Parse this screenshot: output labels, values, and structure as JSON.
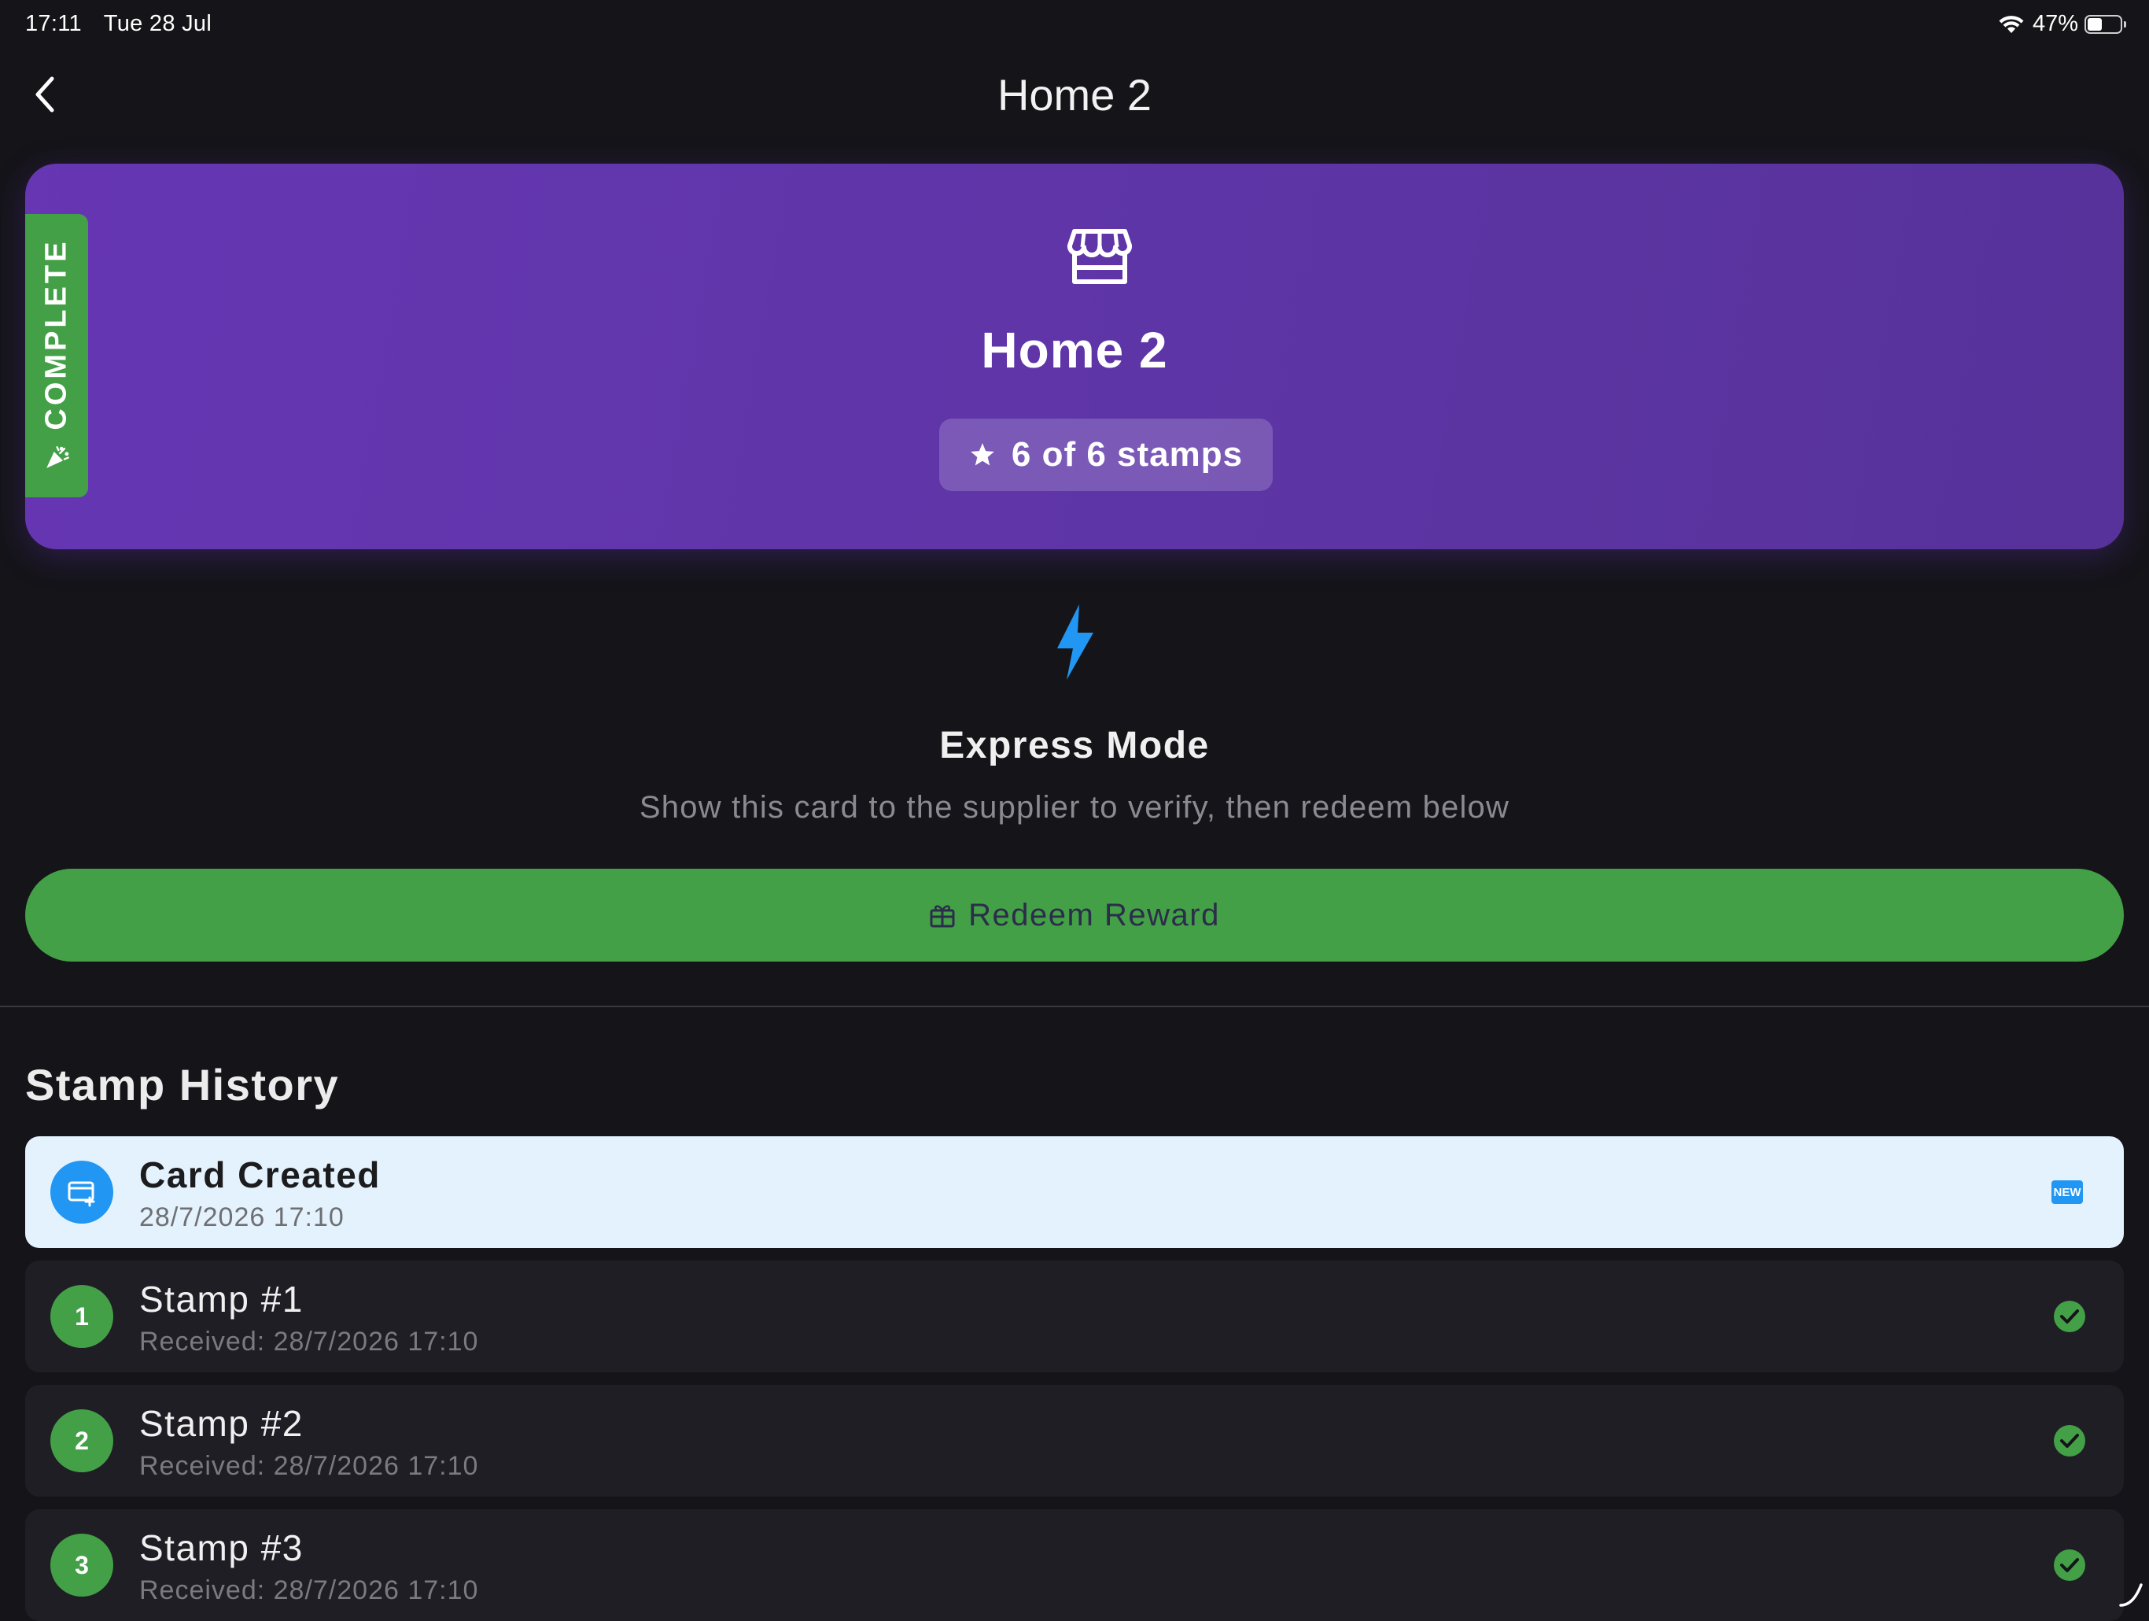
{
  "status_bar": {
    "time": "17:11",
    "date": "Tue 28 Jul",
    "battery_percent": "47%",
    "battery_level": 0.47
  },
  "nav": {
    "title": "Home 2",
    "back_icon": "chevron-left-icon"
  },
  "card": {
    "name": "Home 2",
    "stamp_summary": "6 of 6 stamps",
    "status_ribbon": "COMPLETE",
    "icons": [
      "store-icon",
      "star-icon",
      "party-popper-icon"
    ],
    "colors": {
      "gradient_start": "#6636b3",
      "gradient_end": "#57329a",
      "ribbon": "#43a047"
    }
  },
  "express": {
    "icon": "bolt-icon",
    "title": "Express Mode",
    "subtitle": "Show this card to the supplier to verify, then redeem below",
    "accent": "#2196f3"
  },
  "redeem": {
    "label": "Redeem Reward",
    "icon": "gift-icon",
    "color": "#43a047"
  },
  "history": {
    "title": "Stamp History",
    "items": [
      {
        "title": "Card Created",
        "subtitle": "28/7/2026 17:10",
        "badge": "",
        "icon": "card-add-icon",
        "trail": "NEW",
        "highlight": true
      },
      {
        "title": "Stamp #1",
        "subtitle": "Received: 28/7/2026 17:10",
        "badge": "1",
        "trail": "check-icon",
        "highlight": false
      },
      {
        "title": "Stamp #2",
        "subtitle": "Received: 28/7/2026 17:10",
        "badge": "2",
        "trail": "check-icon",
        "highlight": false
      },
      {
        "title": "Stamp #3",
        "subtitle": "Received: 28/7/2026 17:10",
        "badge": "3",
        "trail": "check-icon",
        "highlight": false
      }
    ]
  }
}
